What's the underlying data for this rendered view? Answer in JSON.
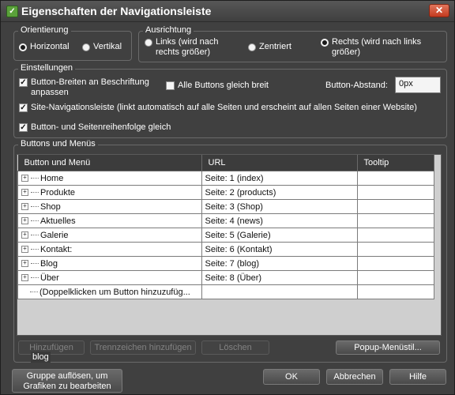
{
  "window": {
    "title": "Eigenschaften der Navigationsleiste",
    "icon": "navbar-app-icon",
    "close_label": "✕"
  },
  "orientierung": {
    "label": "Orientierung",
    "options": [
      {
        "label": "Horizontal",
        "selected": true
      },
      {
        "label": "Vertikal",
        "selected": false
      }
    ]
  },
  "ausrichtung": {
    "label": "Ausrichtung",
    "options": [
      {
        "label": "Links (wird nach rechts größer)",
        "selected": false
      },
      {
        "label": "Zentriert",
        "selected": false
      },
      {
        "label": "Rechts (wird nach links größer)",
        "selected": true
      }
    ]
  },
  "einstellungen": {
    "label": "Einstellungen",
    "button_widths_label": "Button-Breiten an Beschriftung anpassen",
    "button_widths_checked": true,
    "all_same_label": "Alle Buttons gleich breit",
    "all_same_checked": false,
    "spacing_label": "Button-Abstand:",
    "spacing_value": "0px",
    "site_nav_label": "Site-Navigationsleiste (linkt automatisch auf alle Seiten und erscheint auf allen Seiten einer Website)",
    "site_nav_checked": true,
    "order_label": "Button- und Seitenreihenfolge gleich",
    "order_checked": true
  },
  "buttons_menus": {
    "label": "Buttons und Menüs",
    "columns": [
      "Button und Menü",
      "URL",
      "Tooltip"
    ],
    "rows": [
      {
        "name": "Home",
        "url": "Seite: 1 (index)",
        "tooltip": ""
      },
      {
        "name": "Produkte",
        "url": "Seite: 2 (products)",
        "tooltip": ""
      },
      {
        "name": "Shop",
        "url": "Seite: 3 (Shop)",
        "tooltip": ""
      },
      {
        "name": "Aktuelles",
        "url": "Seite: 4 (news)",
        "tooltip": ""
      },
      {
        "name": "Galerie",
        "url": "Seite: 5 (Galerie)",
        "tooltip": ""
      },
      {
        "name": "Kontakt:",
        "url": "Seite: 6 (Kontakt)",
        "tooltip": ""
      },
      {
        "name": "Blog",
        "url": "Seite: 7 (blog)",
        "tooltip": ""
      },
      {
        "name": "Über",
        "url": "Seite: 8 (Über)",
        "tooltip": ""
      }
    ],
    "add_row": "(Doppelklicken um Button hinzuzufüg...",
    "add_button": "Hinzufügen",
    "separator_button": "Trennzeichen hinzufügen",
    "delete_button": "Löschen",
    "popup_button": "Popup-Menüstil..."
  },
  "tooltip_popup": "blog",
  "footer": {
    "ungroup_button": "Gruppe auflösen, um Grafiken zu bearbeiten",
    "ok_button": "OK",
    "cancel_button": "Abbrechen",
    "help_button": "Hilfe"
  }
}
